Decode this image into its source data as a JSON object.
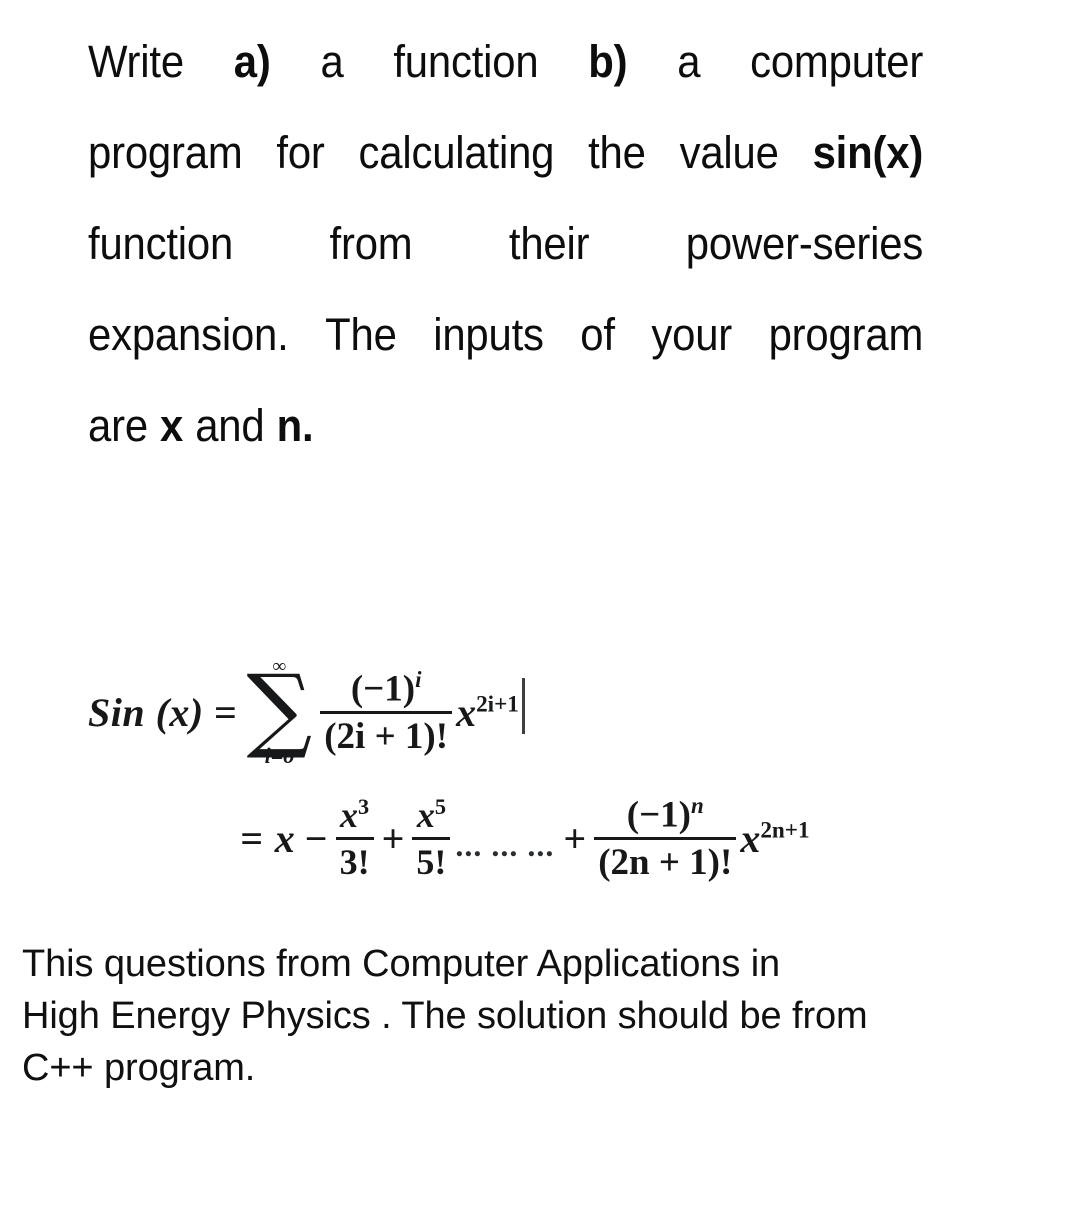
{
  "document": {
    "question": {
      "lines": [
        {
          "segments": [
            {
              "text": "Write",
              "bold": false
            },
            {
              "text": "a)",
              "bold": true
            },
            {
              "text": "a",
              "bold": false
            },
            {
              "text": "function",
              "bold": false
            },
            {
              "text": "b)",
              "bold": true
            },
            {
              "text": "a",
              "bold": false
            },
            {
              "text": "computer",
              "bold": false
            }
          ]
        },
        {
          "segments": [
            {
              "text": "program",
              "bold": false
            },
            {
              "text": "for",
              "bold": false
            },
            {
              "text": "calculating",
              "bold": false
            },
            {
              "text": "the",
              "bold": false
            },
            {
              "text": "value",
              "bold": false
            },
            {
              "text": "sin(x)",
              "bold": true
            }
          ]
        },
        {
          "segments": [
            {
              "text": "function",
              "bold": false
            },
            {
              "text": "from",
              "bold": false
            },
            {
              "text": "their",
              "bold": false
            },
            {
              "text": "power-series",
              "bold": false
            }
          ]
        },
        {
          "segments": [
            {
              "text": "expansion.",
              "bold": false
            },
            {
              "text": "The",
              "bold": false
            },
            {
              "text": "inputs",
              "bold": false
            },
            {
              "text": "of",
              "bold": false
            },
            {
              "text": "your",
              "bold": false
            },
            {
              "text": "program",
              "bold": false
            }
          ]
        },
        {
          "segments": [
            {
              "text": "are",
              "bold": false
            },
            {
              "text": "x",
              "bold": true
            },
            {
              "text": "and",
              "bold": false
            },
            {
              "text": "n.",
              "bold": true
            }
          ]
        }
      ],
      "plain_text": "Write a) a function b) a computer program for calculating the value sin(x) function from their power-series expansion. The inputs of your program are x and n."
    },
    "formula": {
      "line1": {
        "lhs": "Sin (x)",
        "equals": "=",
        "summation": {
          "symbol": "∑",
          "upper_limit": "∞",
          "lower_limit": "i=o"
        },
        "fraction": {
          "numerator": "(−1)",
          "numerator_exponent": "i",
          "denominator": "(2i + 1)!"
        },
        "term_base": "x",
        "term_exponent": "2i+1",
        "cursor_artifact": "|"
      },
      "line2": {
        "equals": "=",
        "first_term": "x",
        "minus": "−",
        "frac1": {
          "numerator": "x",
          "numerator_exponent": "3",
          "denominator": "3!"
        },
        "plus1": "+",
        "frac2": {
          "numerator": "x",
          "numerator_exponent": "5",
          "denominator": "5!"
        },
        "ellipsis": "... ... ...",
        "plus2": "+",
        "frac3": {
          "numerator": "(−1)",
          "numerator_exponent": "n",
          "denominator": "(2n + 1)!"
        },
        "term_base": "x",
        "term_exponent": "2n+1"
      },
      "plain_text": "Sin (x) = ∑(i=o..∞) (−1)^i/(2i + 1)! x^(2i+1) = x − x^3/3! + x^5/5! ... ... ... + (−1)^n/(2n + 1)! x^(2n+1)"
    },
    "note": {
      "lines": [
        "This questions from Computer Applications in",
        "High Energy Physics . The solution should be from",
        "C++ program."
      ],
      "plain_text": "This questions from Computer Applications in High Energy Physics . The solution should be from C++ program."
    }
  },
  "colors": {
    "background": "#ffffff",
    "text": "#0d0d0d",
    "formula_text": "#16181a",
    "cursor": "#3c3f43"
  }
}
